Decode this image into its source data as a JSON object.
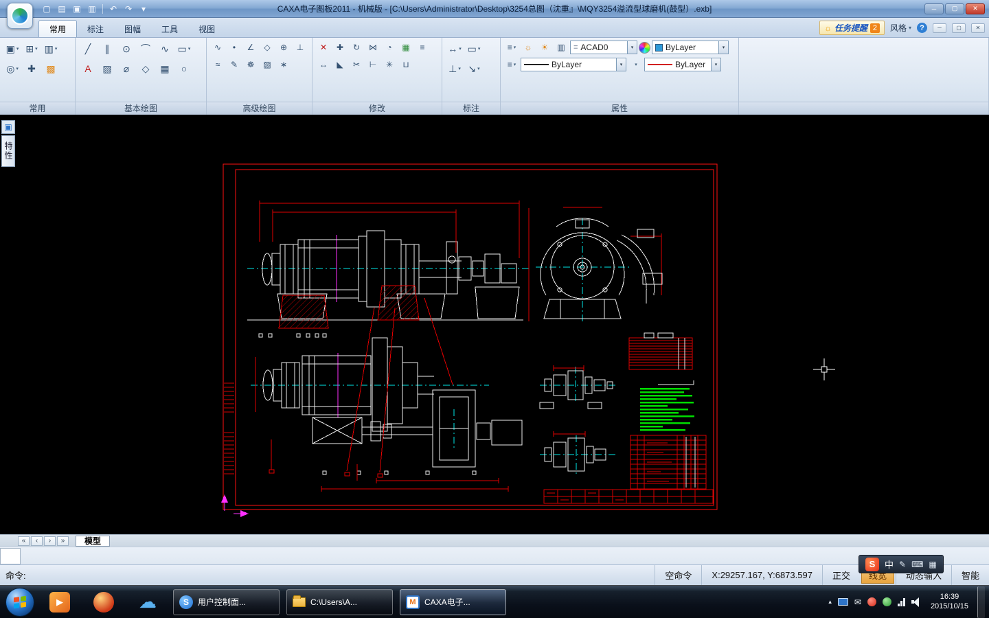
{
  "titlebar": {
    "title": "CAXA电子图板2011 - 机械版 - [C:\\Users\\Administrator\\Desktop\\3254总图（沈重』\\MQY3254溢流型球磨机(鼓型）.exb]"
  },
  "ribbon": {
    "tabs": [
      {
        "label": "常用"
      },
      {
        "label": "标注"
      },
      {
        "label": "图幅"
      },
      {
        "label": "工具"
      },
      {
        "label": "视图"
      }
    ],
    "task_reminder": {
      "label": "任务提醒",
      "badge": "2"
    },
    "style_label": "风格",
    "groups": {
      "common": "常用",
      "basic": "基本绘图",
      "advanced": "高级绘图",
      "modify": "修改",
      "annotate": "标注",
      "props": "属性"
    },
    "properties": {
      "layer": "ACAD0",
      "color": "ByLayer",
      "linetype": "ByLayer",
      "lineweight": "ByLayer"
    }
  },
  "icons": {
    "new": "▢",
    "open": "▤",
    "save": "▣",
    "print": "▥",
    "undo": "↶",
    "redo": "↷",
    "overflow": "▾",
    "minimize": "─",
    "maximize": "▢",
    "close": "✕",
    "help": "?",
    "reminder": "☼",
    "paste": "▣",
    "copy": "⊞",
    "format": "▥",
    "zoom": "◎",
    "pan": "✚",
    "display": "▩",
    "line": "╱",
    "parallel": "∥",
    "circle": "⊙",
    "arc": "⌒",
    "curve": "∿",
    "rect": "▭",
    "text": "A",
    "hatch": "▨",
    "diameter": "⌀",
    "polygon": "◇",
    "grid": "▦",
    "ellipse": "○",
    "spline": "∿",
    "point": "•",
    "angle": "∠",
    "center": "⊕",
    "perp": "⊥",
    "wave": "≈",
    "pen": "✎",
    "gear": "☸",
    "section": "▨",
    "axis": "∗",
    "erase": "✕",
    "move": "✚",
    "rotate": "↻",
    "mirror": "⋈",
    "scale": "◔",
    "array": "▦",
    "offset": "≡",
    "stretch": "↔",
    "corner": "◣",
    "trim": "✂",
    "extend": "⊢",
    "explode": "✳",
    "join": "⊔",
    "dim": "↔",
    "frame": "▭",
    "datum": "⊥",
    "leader": "↘",
    "layers": "≡",
    "bulb": "☼",
    "sun": "☀",
    "printer": "▥",
    "linetype": "≡",
    "nav_first": "«",
    "nav_prev": "‹",
    "nav_next": "›",
    "nav_last": "»",
    "play": "▶",
    "cloud": "☁",
    "mail": "✉",
    "tray_expand": "▴",
    "ime_pen": "✎",
    "ime_kbd": "⌨",
    "ime_tools": "▦",
    "s_logo": "S",
    "caxa_m": "M"
  },
  "panel": {
    "tab": "特性"
  },
  "sheetbar": {
    "model": "模型"
  },
  "cmdbar": {
    "prompt": "命令:",
    "status": "空命令",
    "coords": "X:29257.167, Y:6873.597",
    "ortho": "正交",
    "lineweight": "线宽",
    "dyninput": "动态输入",
    "smart": "智能"
  },
  "ime": {
    "mode": "中"
  },
  "taskbar": {
    "buttons": [
      {
        "label": "用户控制面..."
      },
      {
        "label": "C:\\Users\\A..."
      },
      {
        "label": "CAXA电子..."
      }
    ],
    "clock": {
      "time": "16:39",
      "date": "2015/10/15"
    }
  }
}
